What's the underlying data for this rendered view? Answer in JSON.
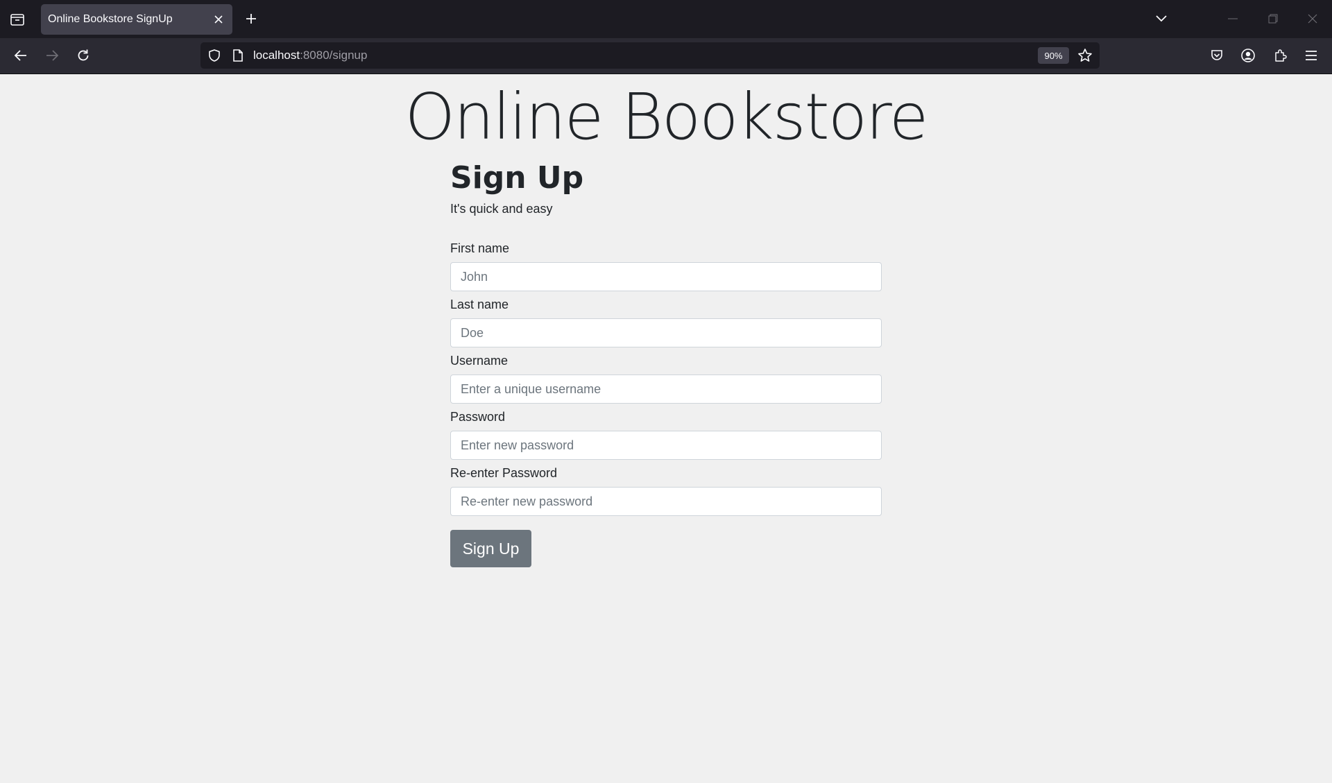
{
  "browser": {
    "tab_title": "Online Bookstore SignUp",
    "url_host": "localhost",
    "url_path": ":8080/signup",
    "zoom": "90%"
  },
  "page": {
    "site_title": "Online Bookstore",
    "heading": "Sign Up",
    "subheading": "It's quick and easy",
    "fields": [
      {
        "label": "First name",
        "placeholder": "John",
        "value": ""
      },
      {
        "label": "Last name",
        "placeholder": "Doe",
        "value": ""
      },
      {
        "label": "Username",
        "placeholder": "Enter a unique username",
        "value": ""
      },
      {
        "label": "Password",
        "placeholder": "Enter new password",
        "value": ""
      },
      {
        "label": "Re-enter Password",
        "placeholder": "Re-enter new password",
        "value": ""
      }
    ],
    "submit_label": "Sign Up"
  },
  "colors": {
    "page_background": "#f0f0f0",
    "text": "#212529",
    "button": "#6c757d",
    "browser_chrome": "#1c1b22",
    "toolbar": "#2b2a33"
  },
  "icons": {
    "tab_list": "tab-list-icon",
    "close": "close-icon",
    "new_tab": "plus-icon",
    "overflow": "chevron-down-icon",
    "back": "arrow-left-icon",
    "forward": "arrow-right-icon",
    "reload": "reload-icon",
    "shield": "shield-icon",
    "page": "page-icon",
    "bookmark": "star-icon",
    "pocket": "pocket-icon",
    "account": "account-icon",
    "extensions": "puzzle-icon",
    "menu": "hamburger-menu-icon"
  }
}
